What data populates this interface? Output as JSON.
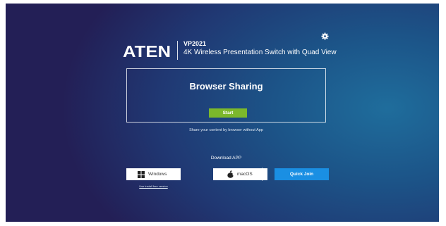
{
  "brand": {
    "logo_text": "ATEN",
    "model": "VP2021",
    "product_name": "4K Wireless Presentation Switch with Quad View"
  },
  "settings": {
    "icon": "gear-icon"
  },
  "browser_sharing": {
    "title": "Browser Sharing",
    "start_label": "Start",
    "hint": "Share your content by browser without App"
  },
  "download": {
    "label": "Download APP",
    "windows_label": "Windows",
    "windows_icon": "windows-icon",
    "macos_label": "macOS",
    "macos_icon": "apple-icon",
    "quick_join_label": "Quick Join",
    "install_free_label": "Use install free version"
  },
  "colors": {
    "start_button": "#7cb82b",
    "quick_join_button": "#1a8fe3",
    "background_dark": "#231f56",
    "background_light": "#1f6d9c"
  }
}
